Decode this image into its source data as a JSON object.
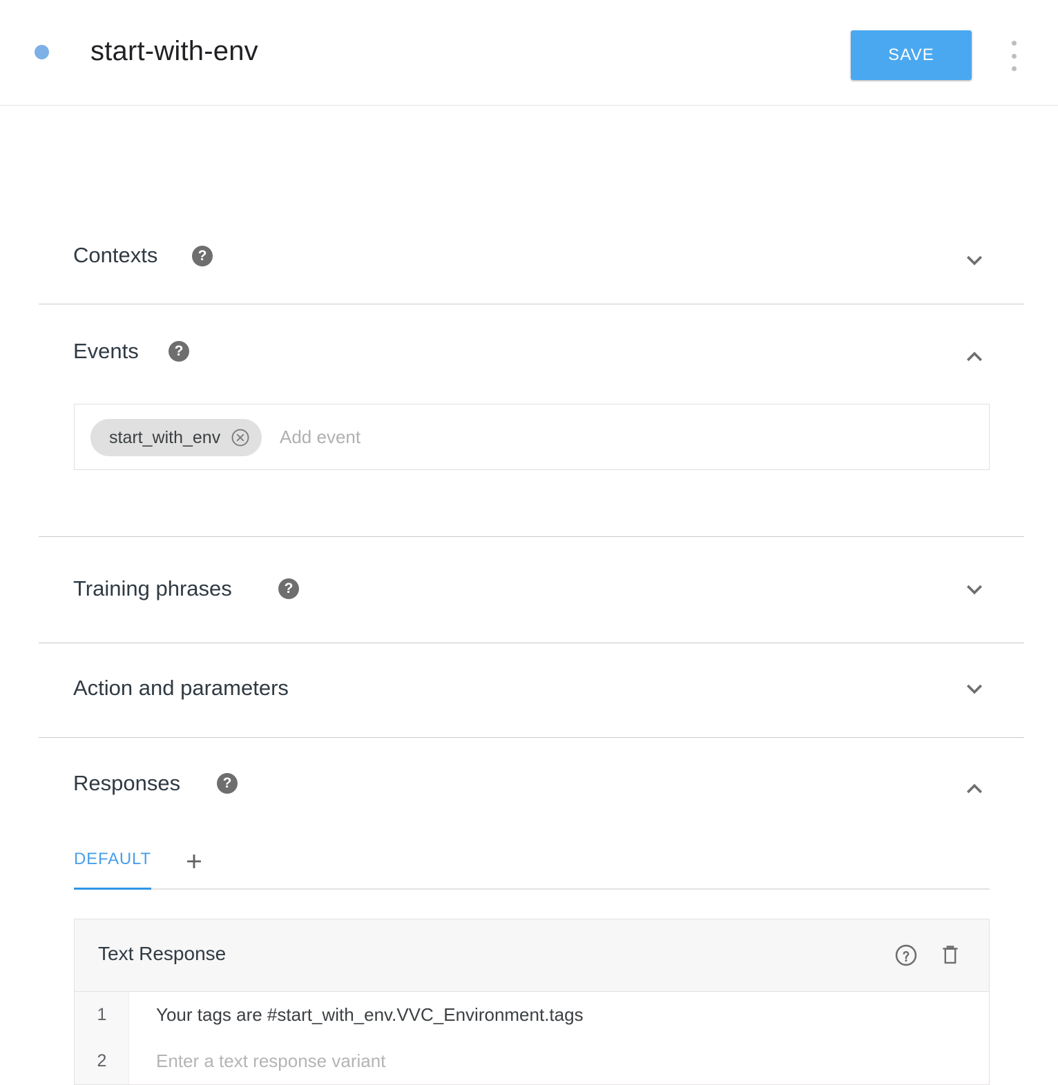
{
  "header": {
    "title": "start-with-env",
    "status_dot_color": "#7cb0e6",
    "save_label": "SAVE",
    "save_color": "#4aa8f0",
    "menu_icon": "more-vert-icon"
  },
  "sections": {
    "contexts": {
      "title": "Contexts",
      "help_icon": "help-icon",
      "chevron_icon": "chevron-down-icon",
      "expanded": false
    },
    "events": {
      "title": "Events",
      "help_icon": "help-icon",
      "chevron_icon": "chevron-up-icon",
      "expanded": true,
      "chips": [
        {
          "label": "start_with_env",
          "remove_icon": "circle-close-icon"
        }
      ],
      "placeholder": "Add event"
    },
    "training_phrases": {
      "title": "Training phrases",
      "help_icon": "help-icon",
      "chevron_icon": "chevron-down-icon",
      "expanded": false
    },
    "action_and_parameters": {
      "title": "Action and parameters",
      "chevron_icon": "chevron-down-icon",
      "expanded": false
    },
    "responses": {
      "title": "Responses",
      "help_icon": "help-icon",
      "chevron_icon": "chevron-up-icon",
      "expanded": true,
      "tabs": [
        {
          "label": "DEFAULT",
          "active": true
        }
      ],
      "add_tab_icon": "plus-icon",
      "accent_color": "#2f96e8",
      "card": {
        "title": "Text Response",
        "help_icon": "help-outline-icon",
        "delete_icon": "trash-icon",
        "rows": [
          {
            "index": "1",
            "value": "Your tags are #start_with_env.VVC_Environment.tags",
            "placeholder": ""
          },
          {
            "index": "2",
            "value": "",
            "placeholder": "Enter a text response variant"
          }
        ]
      }
    }
  }
}
